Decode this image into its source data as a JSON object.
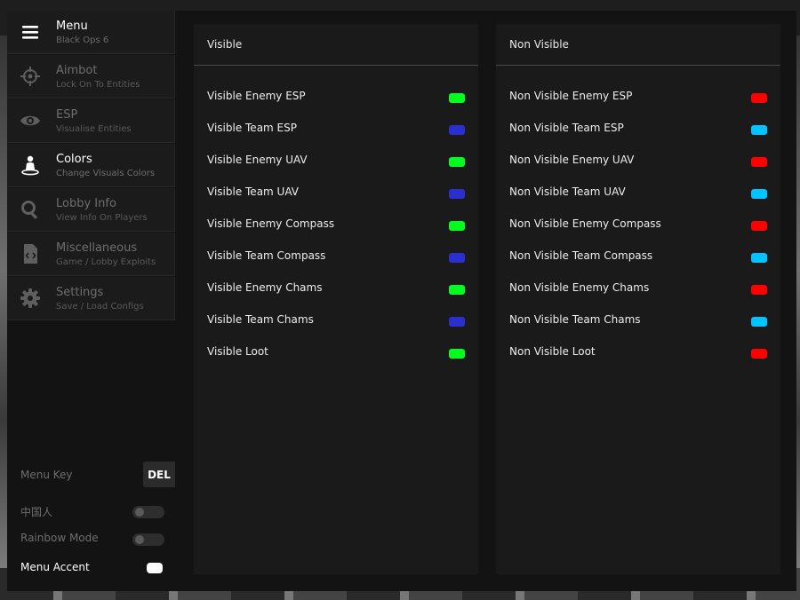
{
  "header": {
    "title": "Menu",
    "subtitle": "Black Ops 6"
  },
  "sidebar": {
    "items": [
      {
        "label": "Aimbot",
        "sub": "Lock On To Entities"
      },
      {
        "label": "ESP",
        "sub": "Visualise Entities"
      },
      {
        "label": "Colors",
        "sub": "Change Visuals Colors"
      },
      {
        "label": "Lobby Info",
        "sub": "View Info On Players"
      },
      {
        "label": "Miscellaneous",
        "sub": "Game / Lobby Exploits"
      },
      {
        "label": "Settings",
        "sub": "Save / Load Configs"
      }
    ],
    "active": "Colors"
  },
  "bottom": {
    "menu_key_label": "Menu Key",
    "menu_key_value": "DEL",
    "chinese_label": "中国人",
    "chinese_on": false,
    "rainbow_label": "Rainbow Mode",
    "rainbow_on": false,
    "accent_label": "Menu Accent",
    "accent_color": "#ffffff"
  },
  "visible_panel": {
    "title": "Visible",
    "rows": [
      {
        "label": "Visible Enemy ESP",
        "color": "#00ff1e"
      },
      {
        "label": "Visible Team ESP",
        "color": "#2b2fd0"
      },
      {
        "label": "Visible Enemy UAV",
        "color": "#00ff1e"
      },
      {
        "label": "Visible Team UAV",
        "color": "#2b2fd0"
      },
      {
        "label": "Visible Enemy Compass",
        "color": "#00ff1e"
      },
      {
        "label": "Visible Team Compass",
        "color": "#2b2fd0"
      },
      {
        "label": "Visible Enemy Chams",
        "color": "#00ff1e"
      },
      {
        "label": "Visible Team Chams",
        "color": "#2b2fd0"
      },
      {
        "label": "Visible Loot",
        "color": "#00ff1e"
      }
    ]
  },
  "nonvisible_panel": {
    "title": "Non Visible",
    "rows": [
      {
        "label": "Non Visible Enemy ESP",
        "color": "#ff0000"
      },
      {
        "label": "Non Visible Team ESP",
        "color": "#00c3ff"
      },
      {
        "label": "Non Visible Enemy UAV",
        "color": "#ff0000"
      },
      {
        "label": "Non Visible Team UAV",
        "color": "#00c3ff"
      },
      {
        "label": "Non Visible Enemy Compass",
        "color": "#ff0000"
      },
      {
        "label": "Non Visible Team Compass",
        "color": "#00c3ff"
      },
      {
        "label": "Non Visible Enemy Chams",
        "color": "#ff0000"
      },
      {
        "label": "Non Visible Team Chams",
        "color": "#00c3ff"
      },
      {
        "label": "Non Visible Loot",
        "color": "#ff0000"
      }
    ]
  }
}
